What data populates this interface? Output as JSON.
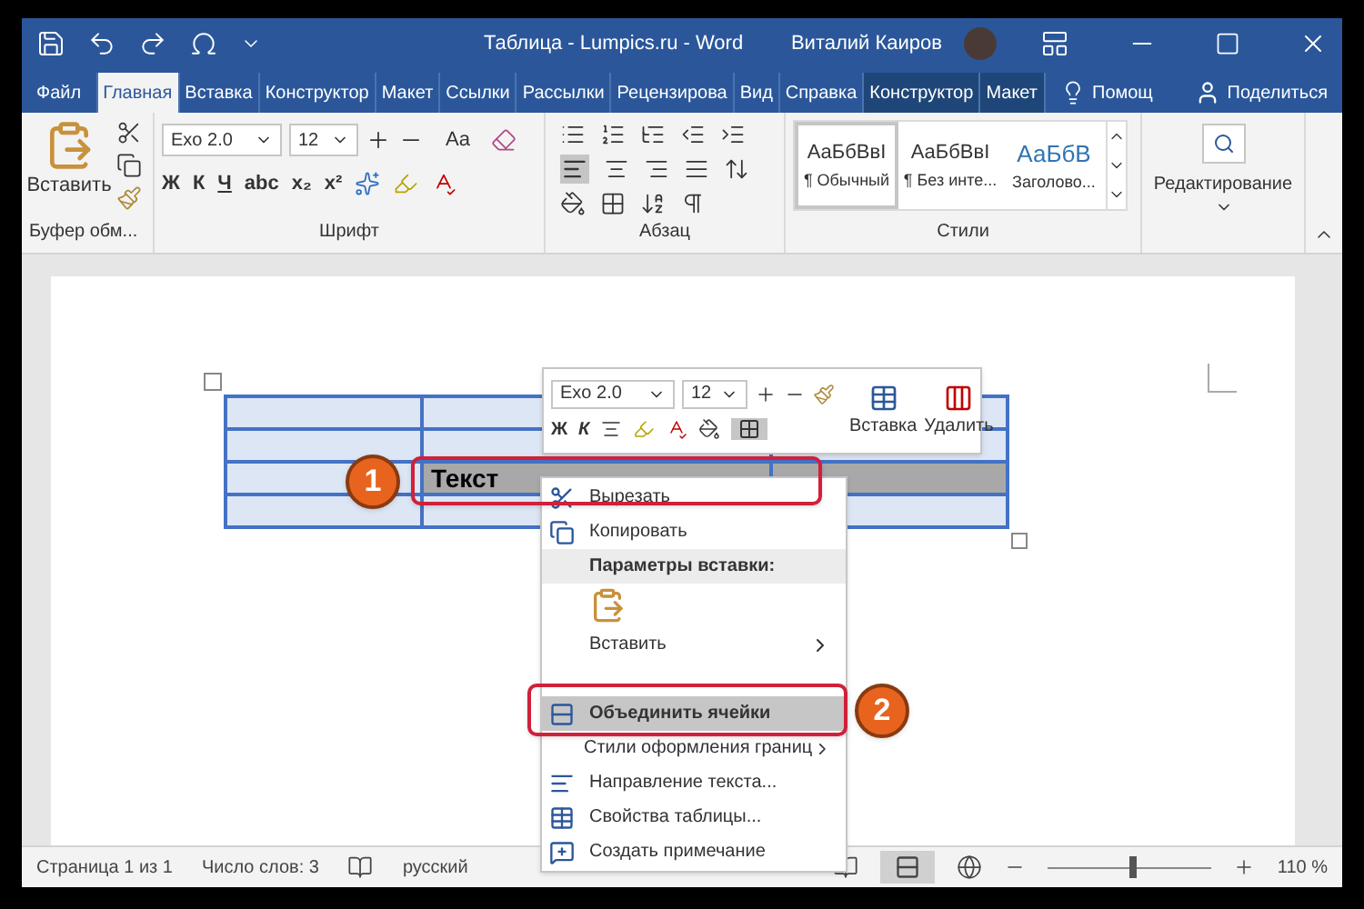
{
  "title_bar": {
    "title": "Таблица - Lumpics.ru  -  Word",
    "user": "Виталий Каиров"
  },
  "tabs": [
    {
      "label": "Файл",
      "kind": "file",
      "selected": false
    },
    {
      "label": "Главная",
      "kind": "normal",
      "selected": true
    },
    {
      "label": "Вставка",
      "kind": "normal",
      "selected": false
    },
    {
      "label": "Конструктор",
      "kind": "normal",
      "selected": false
    },
    {
      "label": "Макет",
      "kind": "normal",
      "selected": false
    },
    {
      "label": "Ссылки",
      "kind": "normal",
      "selected": false
    },
    {
      "label": "Рассылки",
      "kind": "normal",
      "selected": false
    },
    {
      "label": "Рецензирова",
      "kind": "normal",
      "selected": false
    },
    {
      "label": "Вид",
      "kind": "normal",
      "selected": false
    },
    {
      "label": "Справка",
      "kind": "normal",
      "selected": false
    },
    {
      "label": "Конструктор",
      "kind": "context",
      "selected": false
    },
    {
      "label": "Макет",
      "kind": "context",
      "selected": false
    }
  ],
  "tell_me": "Помощ",
  "share": "Поделиться",
  "ribbon": {
    "clipboard": {
      "paste": "Вставить",
      "group": "Буфер обм..."
    },
    "font": {
      "name": "Exo 2.0",
      "size": "12",
      "case": "Aa",
      "buttons": [
        "Ж",
        "К",
        "Ч",
        "abc",
        "x₂",
        "x²"
      ],
      "group": "Шрифт"
    },
    "paragraph": {
      "group": "Абзац"
    },
    "styles": {
      "items": [
        {
          "preview": "АаБбВвI",
          "name": "¶ Обычный",
          "selected": true
        },
        {
          "preview": "АаБбВвI",
          "name": "¶ Без инте...",
          "selected": false
        },
        {
          "preview": "АаБбВ",
          "name": "Заголово...",
          "selected": false
        }
      ],
      "group": "Стили"
    },
    "editing": {
      "label": "Редактирование"
    }
  },
  "table": {
    "rows": [
      [
        {
          "text": "",
          "selected": false
        },
        {
          "text": "",
          "selected": false
        },
        {
          "text": "",
          "selected": false
        }
      ],
      [
        {
          "text": "",
          "selected": false
        },
        {
          "text": "",
          "selected": false
        },
        {
          "text": "",
          "selected": false
        }
      ],
      [
        {
          "text": "",
          "selected": false
        },
        {
          "text": "Текст",
          "selected": true
        },
        {
          "text": "",
          "selected": true
        }
      ],
      [
        {
          "text": "",
          "selected": false
        },
        {
          "text": "",
          "selected": false
        },
        {
          "text": "",
          "selected": false
        }
      ]
    ]
  },
  "mini_toolbar": {
    "font": "Exo 2.0",
    "size": "12",
    "bold": "Ж",
    "italic": "К",
    "insert": "Вставка",
    "delete": "Удалить"
  },
  "context_menu": [
    {
      "kind": "cut",
      "label": "Вырезать",
      "selected": false
    },
    {
      "kind": "copy",
      "label": "Копировать",
      "selected": false
    },
    {
      "kind": "header",
      "label": "Параметры вставки:"
    },
    {
      "kind": "paste_option"
    },
    {
      "kind": "submenu",
      "label": "Вставить",
      "selected": false
    },
    {
      "kind": "hidden"
    },
    {
      "kind": "merge",
      "label": "Объединить ячейки",
      "selected": true
    },
    {
      "kind": "submenu",
      "label": "Стили оформления границ",
      "selected": false
    },
    {
      "kind": "direction",
      "label": "Направление текста...",
      "selected": false
    },
    {
      "kind": "properties",
      "label": "Свойства таблицы...",
      "selected": false
    },
    {
      "kind": "comment",
      "label": "Создать примечание",
      "selected": false
    }
  ],
  "callouts": [
    {
      "number": "1"
    },
    {
      "number": "2"
    }
  ],
  "status_bar": {
    "page": "Страница 1 из 1",
    "words": "Число слов: 3",
    "language": "русский",
    "zoom": {
      "level": 0.52,
      "reading": "110 %"
    }
  }
}
